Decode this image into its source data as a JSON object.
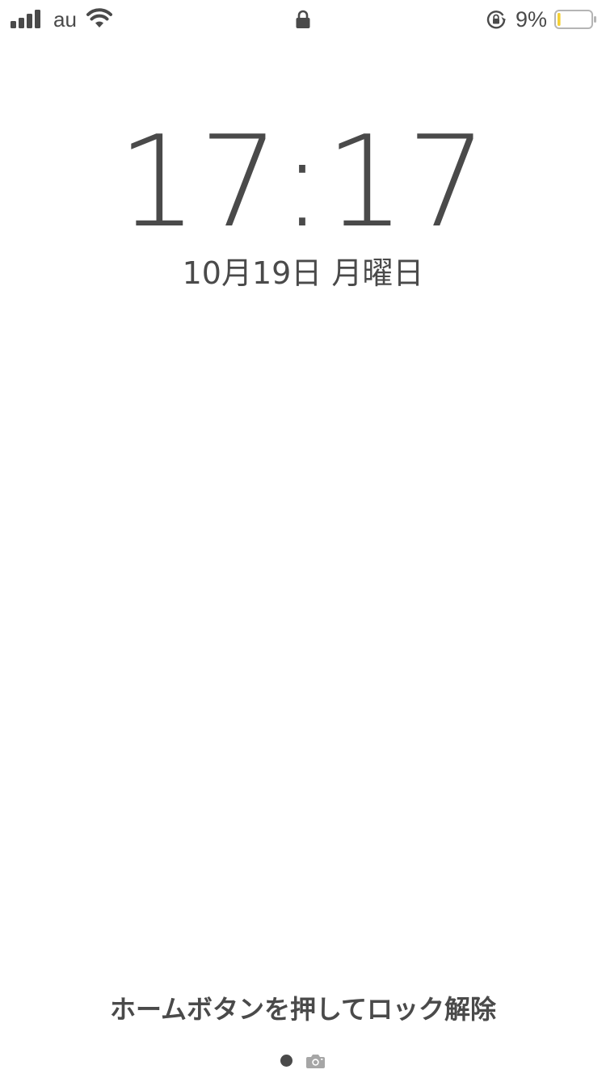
{
  "status_bar": {
    "carrier": "au",
    "battery_percent_label": "9%",
    "battery_level": 0.09,
    "battery_color": "#f5d033",
    "icons": [
      "signal-icon",
      "wifi-icon",
      "lock-icon",
      "rotation-lock-icon",
      "battery-icon"
    ]
  },
  "lock_screen": {
    "time": "17:17",
    "date": "10月19日 月曜日",
    "unlock_hint": "ホームボタンを押してロック解除"
  },
  "page_indicator": {
    "current_page": 1,
    "icons": [
      "page-dot",
      "camera-icon"
    ]
  },
  "colors": {
    "text": "#4a4a4a",
    "background": "#ffffff"
  }
}
